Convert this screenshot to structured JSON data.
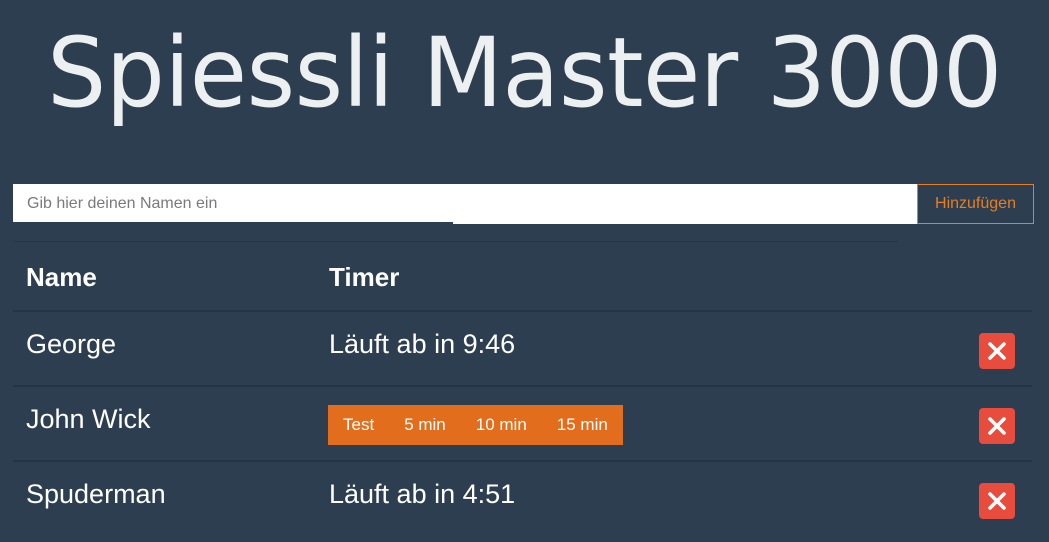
{
  "app": {
    "title": "Spiessli Master 3000"
  },
  "form": {
    "name_placeholder": "Gib hier deinen Namen ein",
    "add_label": "Hinzufügen"
  },
  "table": {
    "headers": {
      "name": "Name",
      "timer": "Timer"
    },
    "rows": [
      {
        "name": "George",
        "timer_text": "Läuft ab in 9:46"
      },
      {
        "name": "John Wick",
        "timer_options": [
          "Test",
          "5 min",
          "10 min",
          "15 min"
        ]
      },
      {
        "name": "Spuderman",
        "timer_text": "Läuft ab in 4:51"
      }
    ]
  },
  "colors": {
    "background": "#2c3e50",
    "accent": "#e67e22",
    "danger": "#e74c3c"
  },
  "icons": {
    "delete": "close-icon"
  }
}
